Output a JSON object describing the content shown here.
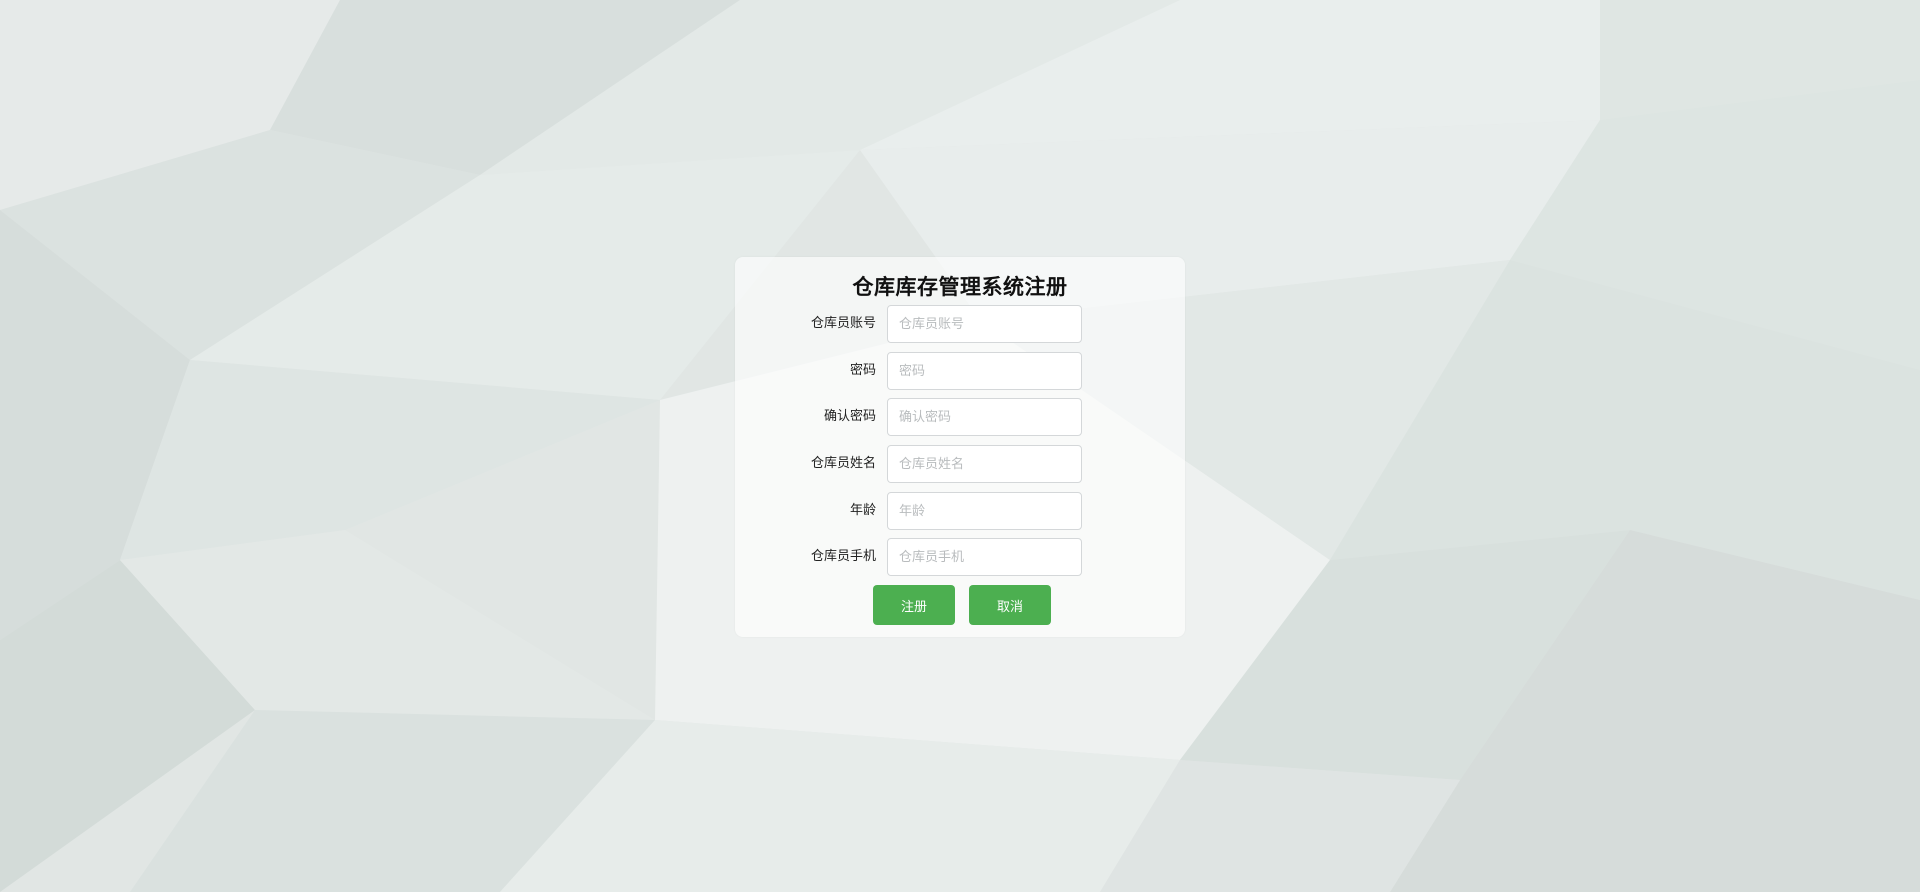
{
  "page": {
    "title": "仓库库存管理系统注册"
  },
  "form": {
    "fields": [
      {
        "label": "仓库员账号",
        "placeholder": "仓库员账号",
        "value": ""
      },
      {
        "label": "密码",
        "placeholder": "密码",
        "value": ""
      },
      {
        "label": "确认密码",
        "placeholder": "确认密码",
        "value": ""
      },
      {
        "label": "仓库员姓名",
        "placeholder": "仓库员姓名",
        "value": ""
      },
      {
        "label": "年龄",
        "placeholder": "年龄",
        "value": ""
      },
      {
        "label": "仓库员手机",
        "placeholder": "仓库员手机",
        "value": ""
      }
    ],
    "register_label": "注册",
    "cancel_label": "取消"
  },
  "colors": {
    "accent": "#4caf50",
    "background": "#e3e8e6"
  }
}
